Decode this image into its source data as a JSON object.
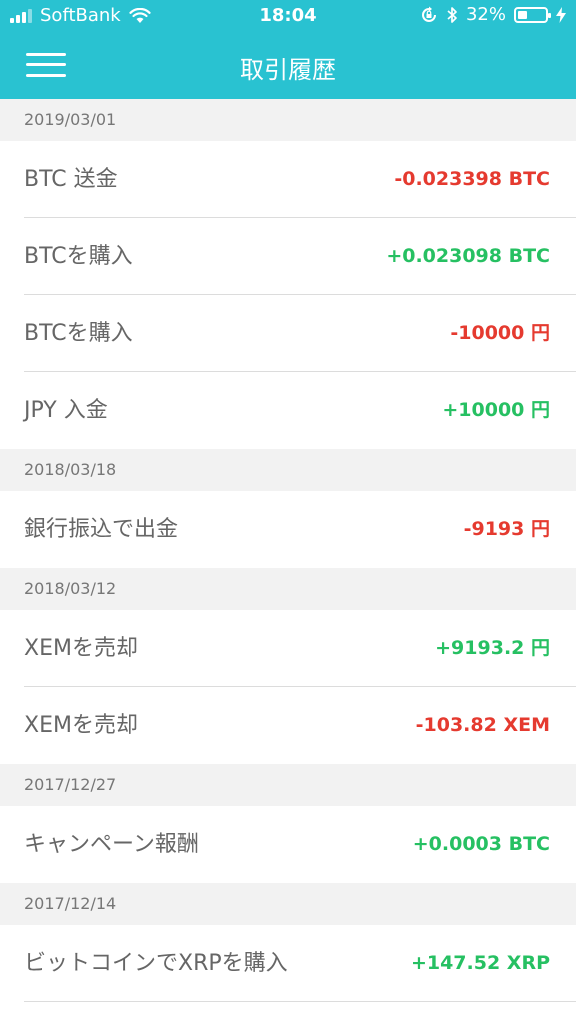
{
  "status_bar": {
    "carrier": "SoftBank",
    "time": "18:04",
    "battery_percent": "32%",
    "battery_level": 0.32,
    "icons": [
      "signal-icon",
      "wifi-icon",
      "rotation-lock-icon",
      "bluetooth-icon",
      "battery-icon",
      "charging-icon"
    ]
  },
  "nav": {
    "title": "取引履歴",
    "menu_icon": "hamburger-menu-icon"
  },
  "colors": {
    "accent": "#29c2d1",
    "negative": "#e53a2f",
    "positive": "#26c062"
  },
  "history": [
    {
      "date": "2019/03/01",
      "items": [
        {
          "label": "BTC 送金",
          "amount": "-0.023398 BTC",
          "type": "neg"
        },
        {
          "label": "BTCを購入",
          "amount": "+0.023098 BTC",
          "type": "pos"
        },
        {
          "label": "BTCを購入",
          "amount": "-10000 円",
          "type": "neg"
        },
        {
          "label": "JPY 入金",
          "amount": "+10000 円",
          "type": "pos"
        }
      ]
    },
    {
      "date": "2018/03/18",
      "items": [
        {
          "label": "銀行振込で出金",
          "amount": "-9193 円",
          "type": "neg"
        }
      ]
    },
    {
      "date": "2018/03/12",
      "items": [
        {
          "label": "XEMを売却",
          "amount": "+9193.2 円",
          "type": "pos"
        },
        {
          "label": "XEMを売却",
          "amount": "-103.82 XEM",
          "type": "neg"
        }
      ]
    },
    {
      "date": "2017/12/27",
      "items": [
        {
          "label": "キャンペーン報酬",
          "amount": "+0.0003 BTC",
          "type": "pos"
        }
      ]
    },
    {
      "date": "2017/12/14",
      "items": [
        {
          "label": "ビットコインでXRPを購入",
          "amount": "+147.52 XRP",
          "type": "pos"
        }
      ]
    }
  ]
}
